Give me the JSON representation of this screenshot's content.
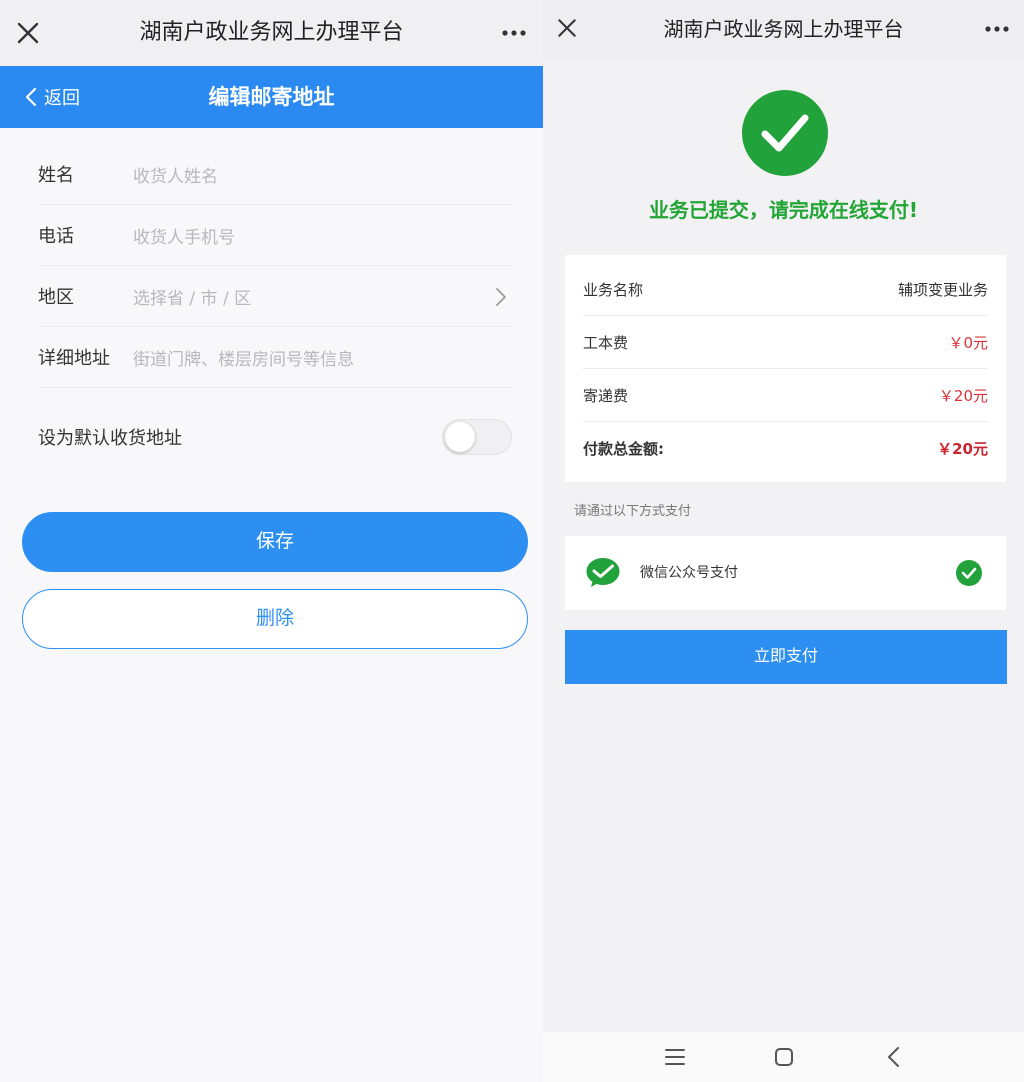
{
  "left": {
    "topbar": {
      "title": "湖南户政业务网上办理平台"
    },
    "header": {
      "back_label": "返回",
      "title": "编辑邮寄地址"
    },
    "form": {
      "fields": [
        {
          "label": "姓名",
          "placeholder": "收货人姓名"
        },
        {
          "label": "电话",
          "placeholder": "收货人手机号"
        },
        {
          "label": "地区",
          "placeholder": "选择省 / 市 / 区"
        },
        {
          "label": "详细地址",
          "placeholder": "街道门牌、楼层房间号等信息"
        }
      ],
      "default_label": "设为默认收货地址",
      "default_on": false
    },
    "buttons": {
      "save": "保存",
      "delete": "删除"
    }
  },
  "right": {
    "topbar": {
      "title": "湖南户政业务网上办理平台"
    },
    "success_message": "业务已提交，请完成在线支付!",
    "details": [
      {
        "label": "业务名称",
        "value": "辅项变更业务"
      },
      {
        "label": "工本费",
        "value": "￥0元"
      },
      {
        "label": "寄递费",
        "value": "￥20元"
      },
      {
        "label": "付款总金额:",
        "value": "￥20元"
      }
    ],
    "pay_hint": "请通过以下方式支付",
    "pay_method": "微信公众号支付",
    "pay_button": "立即支付"
  },
  "colors": {
    "primary_blue": "#2e8ff3",
    "success_green": "#22a23a",
    "amount_red": "#d8333a"
  }
}
